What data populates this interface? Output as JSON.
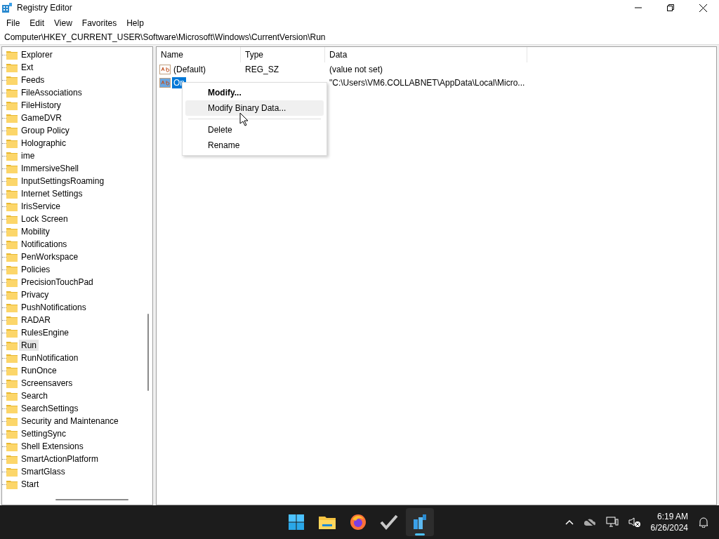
{
  "window": {
    "title": "Registry Editor"
  },
  "menu": [
    "File",
    "Edit",
    "View",
    "Favorites",
    "Help"
  ],
  "address": "Computer\\HKEY_CURRENT_USER\\Software\\Microsoft\\Windows\\CurrentVersion\\Run",
  "tree": [
    {
      "label": "Explorer",
      "selected": false
    },
    {
      "label": "Ext",
      "selected": false
    },
    {
      "label": "Feeds",
      "selected": false
    },
    {
      "label": "FileAssociations",
      "selected": false
    },
    {
      "label": "FileHistory",
      "selected": false
    },
    {
      "label": "GameDVR",
      "selected": false
    },
    {
      "label": "Group Policy",
      "selected": false
    },
    {
      "label": "Holographic",
      "selected": false
    },
    {
      "label": "ime",
      "selected": false
    },
    {
      "label": "ImmersiveShell",
      "selected": false
    },
    {
      "label": "InputSettingsRoaming",
      "selected": false
    },
    {
      "label": "Internet Settings",
      "selected": false
    },
    {
      "label": "IrisService",
      "selected": false
    },
    {
      "label": "Lock Screen",
      "selected": false
    },
    {
      "label": "Mobility",
      "selected": false
    },
    {
      "label": "Notifications",
      "selected": false
    },
    {
      "label": "PenWorkspace",
      "selected": false
    },
    {
      "label": "Policies",
      "selected": false
    },
    {
      "label": "PrecisionTouchPad",
      "selected": false
    },
    {
      "label": "Privacy",
      "selected": false
    },
    {
      "label": "PushNotifications",
      "selected": false
    },
    {
      "label": "RADAR",
      "selected": false
    },
    {
      "label": "RulesEngine",
      "selected": false
    },
    {
      "label": "Run",
      "selected": true
    },
    {
      "label": "RunNotification",
      "selected": false
    },
    {
      "label": "RunOnce",
      "selected": false
    },
    {
      "label": "Screensavers",
      "selected": false
    },
    {
      "label": "Search",
      "selected": false
    },
    {
      "label": "SearchSettings",
      "selected": false
    },
    {
      "label": "Security and Maintenance",
      "selected": false
    },
    {
      "label": "SettingSync",
      "selected": false
    },
    {
      "label": "Shell Extensions",
      "selected": false
    },
    {
      "label": "SmartActionPlatform",
      "selected": false
    },
    {
      "label": "SmartGlass",
      "selected": false
    },
    {
      "label": "Start",
      "selected": false
    }
  ],
  "table": {
    "columns": [
      "Name",
      "Type",
      "Data"
    ],
    "rows": [
      {
        "name": "(Default)",
        "type": "REG_SZ",
        "data": "(value not set)",
        "selected": false
      },
      {
        "name": "On",
        "data": "\"C:\\Users\\VM6.COLLABNET\\AppData\\Local\\Micro...",
        "selected": true
      }
    ]
  },
  "context_menu": [
    {
      "kind": "item",
      "label": "Modify...",
      "default": true,
      "selected": false
    },
    {
      "kind": "item",
      "label": "Modify Binary Data...",
      "default": false,
      "selected": true
    },
    {
      "kind": "separator"
    },
    {
      "kind": "item",
      "label": "Delete",
      "default": false,
      "selected": false
    },
    {
      "kind": "item",
      "label": "Rename",
      "default": false,
      "selected": false
    }
  ],
  "taskbar": {
    "apps": [
      {
        "kind": "start",
        "selected": false
      },
      {
        "kind": "folder",
        "selected": false
      },
      {
        "kind": "browser",
        "selected": false
      },
      {
        "kind": "check",
        "selected": false
      },
      {
        "kind": "regedit",
        "selected": true
      }
    ],
    "time": "6:19 AM",
    "date": "6/26/2024"
  }
}
